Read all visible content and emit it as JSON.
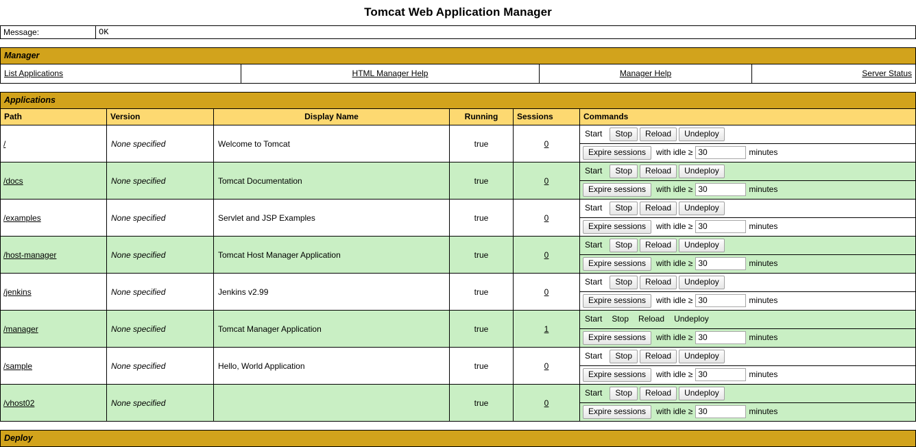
{
  "page": {
    "title": "Tomcat Web Application Manager"
  },
  "message": {
    "label": "Message:",
    "value": "OK"
  },
  "manager": {
    "section_title": "Manager",
    "links": [
      {
        "label": "List Applications"
      },
      {
        "label": "HTML Manager Help"
      },
      {
        "label": "Manager Help"
      },
      {
        "label": "Server Status"
      }
    ]
  },
  "applications": {
    "section_title": "Applications",
    "columns": {
      "path": "Path",
      "version": "Version",
      "display_name": "Display Name",
      "running": "Running",
      "sessions": "Sessions",
      "commands": "Commands"
    },
    "command_labels": {
      "start": "Start",
      "stop": "Stop",
      "reload": "Reload",
      "undeploy": "Undeploy",
      "expire_sessions": "Expire sessions",
      "with_idle": "with idle ≥",
      "minutes": "minutes"
    },
    "rows": [
      {
        "path": "/",
        "version": "None specified",
        "display_name": "Welcome to Tomcat",
        "running": "true",
        "sessions": "0",
        "start_enabled": false,
        "stop_enabled": true,
        "reload_enabled": true,
        "undeploy_enabled": true,
        "idle_minutes": "30",
        "stripe": "white"
      },
      {
        "path": "/docs",
        "version": "None specified",
        "display_name": "Tomcat Documentation",
        "running": "true",
        "sessions": "0",
        "start_enabled": false,
        "stop_enabled": true,
        "reload_enabled": true,
        "undeploy_enabled": true,
        "idle_minutes": "30",
        "stripe": "green"
      },
      {
        "path": "/examples",
        "version": "None specified",
        "display_name": "Servlet and JSP Examples",
        "running": "true",
        "sessions": "0",
        "start_enabled": false,
        "stop_enabled": true,
        "reload_enabled": true,
        "undeploy_enabled": true,
        "idle_minutes": "30",
        "stripe": "white"
      },
      {
        "path": "/host-manager",
        "version": "None specified",
        "display_name": "Tomcat Host Manager Application",
        "running": "true",
        "sessions": "0",
        "start_enabled": false,
        "stop_enabled": true,
        "reload_enabled": true,
        "undeploy_enabled": true,
        "idle_minutes": "30",
        "stripe": "green"
      },
      {
        "path": "/jenkins",
        "version": "None specified",
        "display_name": "Jenkins v2.99",
        "running": "true",
        "sessions": "0",
        "start_enabled": false,
        "stop_enabled": true,
        "reload_enabled": true,
        "undeploy_enabled": true,
        "idle_minutes": "30",
        "stripe": "white"
      },
      {
        "path": "/manager",
        "version": "None specified",
        "display_name": "Tomcat Manager Application",
        "running": "true",
        "sessions": "1",
        "start_enabled": false,
        "stop_enabled": false,
        "reload_enabled": false,
        "undeploy_enabled": false,
        "idle_minutes": "30",
        "stripe": "green"
      },
      {
        "path": "/sample",
        "version": "None specified",
        "display_name": "Hello, World Application",
        "running": "true",
        "sessions": "0",
        "start_enabled": false,
        "stop_enabled": true,
        "reload_enabled": true,
        "undeploy_enabled": true,
        "idle_minutes": "30",
        "stripe": "white"
      },
      {
        "path": "/vhost02",
        "version": "None specified",
        "display_name": "",
        "running": "true",
        "sessions": "0",
        "start_enabled": false,
        "stop_enabled": true,
        "reload_enabled": true,
        "undeploy_enabled": true,
        "idle_minutes": "30",
        "stripe": "green"
      }
    ]
  },
  "deploy": {
    "section_title": "Deploy"
  },
  "colors": {
    "section_bar_gold": "#d2a31c",
    "column_header_gold": "#fdd971",
    "row_green": "#c9efc4",
    "row_white": "#ffffff",
    "border": "#000000"
  }
}
